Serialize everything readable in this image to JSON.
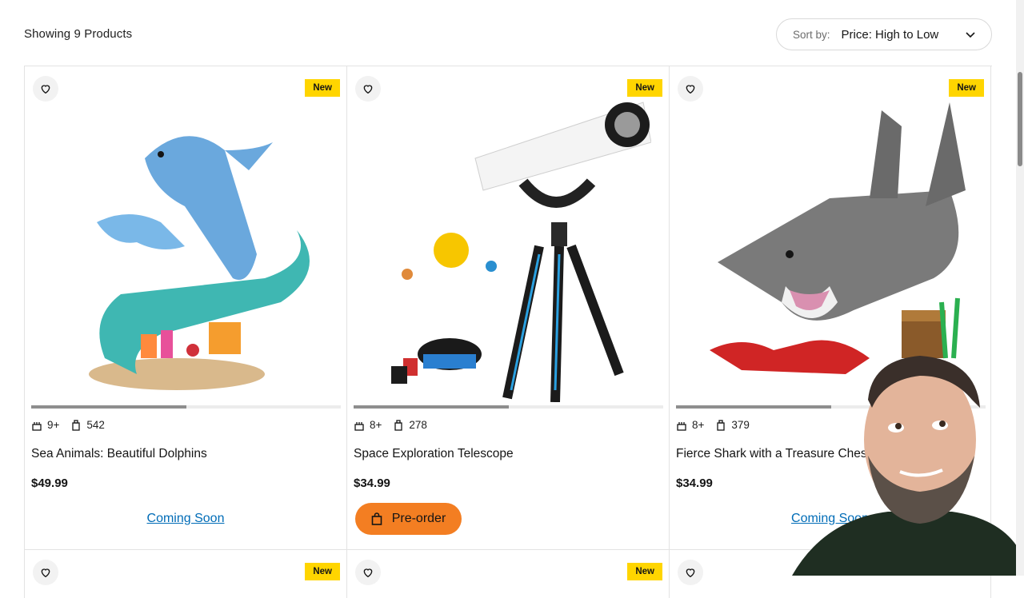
{
  "header": {
    "product_count": "Showing 9 Products",
    "sort_label": "Sort by:",
    "sort_value": "Price: High to Low"
  },
  "products": [
    {
      "badge": "New",
      "age": "9+",
      "pieces": "542",
      "name": "Sea Animals: Beautiful Dolphins",
      "price": "$49.99",
      "action": "Coming Soon",
      "image_progress": 0.5
    },
    {
      "badge": "New",
      "age": "8+",
      "pieces": "278",
      "name": "Space Exploration Telescope",
      "price": "$34.99",
      "action": "Pre-order",
      "image_progress": 0.5
    },
    {
      "badge": "New",
      "age": "8+",
      "pieces": "379",
      "name": "Fierce Shark with a Treasure Chest",
      "price": "$34.99",
      "action": "Coming Soon",
      "image_progress": 0.5
    }
  ],
  "next_row_badges": [
    "New",
    "New"
  ],
  "colors": {
    "badge_yellow": "#ffd500",
    "preorder_orange": "#f37e22",
    "link_blue": "#006cb7"
  }
}
